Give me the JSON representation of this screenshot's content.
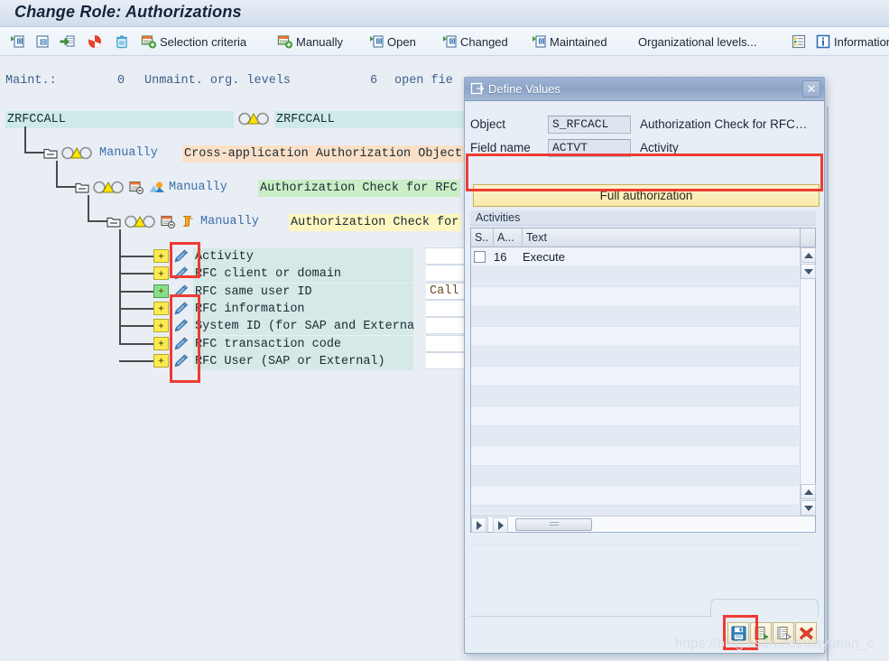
{
  "window": {
    "title": "Change Role: Authorizations"
  },
  "toolbar": {
    "items": [
      {
        "icon": "expand-all-icon",
        "label": ""
      },
      {
        "icon": "collapse-all-icon",
        "label": ""
      },
      {
        "icon": "insert-row-icon",
        "label": ""
      },
      {
        "icon": "deactivate-icon",
        "label": ""
      },
      {
        "icon": "delete-trash-icon",
        "label": ""
      },
      {
        "icon": "selection-criteria-icon",
        "label": "Selection criteria"
      },
      {
        "icon": "manually-icon",
        "label": "Manually"
      },
      {
        "icon": "open-icon",
        "label": "Open"
      },
      {
        "icon": "changed-icon",
        "label": "Changed"
      },
      {
        "icon": "maintained-icon",
        "label": "Maintained"
      },
      {
        "icon": "",
        "label": "Organizational levels..."
      },
      {
        "icon": "org-levels-icon",
        "label": ""
      },
      {
        "icon": "information-icon",
        "label": "Information"
      }
    ]
  },
  "status": {
    "maint_label": "Maint.:",
    "unmaint_count": "0",
    "unmaint_label": "Unmaint. org. levels",
    "open_count": "6",
    "open_label": "open fie"
  },
  "tree": {
    "root": {
      "name": "ZRFCCALL",
      "name2": "ZRFCCALL"
    },
    "nodes": [
      {
        "status": "Manually",
        "text": "Cross-application Authorization Object",
        "highlight": "orange"
      },
      {
        "status": "Manually",
        "text": "Authorization Check for RFC",
        "highlight": "green"
      },
      {
        "status": "Manually",
        "text": "Authorization Check for",
        "highlight": "yellow"
      }
    ],
    "fields": [
      {
        "label": "Activity",
        "chip": "yellow",
        "value": ""
      },
      {
        "label": "RFC client or domain",
        "chip": "yellow",
        "value": ""
      },
      {
        "label": "RFC same user ID",
        "chip": "green",
        "value": "Call"
      },
      {
        "label": "RFC information",
        "chip": "yellow",
        "value": ""
      },
      {
        "label": "System ID (for SAP and Externa",
        "chip": "yellow",
        "value": ""
      },
      {
        "label": "RFC transaction code",
        "chip": "yellow",
        "value": ""
      },
      {
        "label": "RFC User (SAP or External)",
        "chip": "yellow",
        "value": ""
      }
    ]
  },
  "dialog": {
    "title": "Define Values",
    "close_label": "✕",
    "object_label": "Object",
    "object_value": "S_RFCACL",
    "object_desc": "Authorization Check for RFC…",
    "field_label": "Field name",
    "field_value": "ACTVT",
    "field_desc": "Activity",
    "full_auth_label": "Full authorization",
    "group_header": "Activities",
    "table": {
      "columns": [
        "S..",
        "A...",
        "Text"
      ],
      "rows": [
        {
          "selected": false,
          "code": "16",
          "text": "Execute"
        }
      ]
    },
    "buttons": [
      {
        "icon": "save-icon",
        "label": ""
      },
      {
        "icon": "copy-green-icon",
        "label": ""
      },
      {
        "icon": "transfer-icon",
        "label": ""
      },
      {
        "icon": "cancel-red-x-icon",
        "label": ""
      }
    ]
  },
  "watermark": {
    "text": "https://blog.csdn.net/xiayutian_c"
  },
  "colors": {
    "accent_red": "#ee3b33",
    "title_gradient_top": "#e8eef6",
    "dialog_title": "#8ba4c8",
    "highlight_cyan": "#cdeae9",
    "highlight_orange": "#fbe0c8",
    "highlight_green": "#caeec6",
    "highlight_yellow": "#fdf6c0",
    "chip_yellow": "#fbeb4f",
    "chip_green": "#86e08a",
    "full_auth_bg": "#f8e9a8"
  }
}
